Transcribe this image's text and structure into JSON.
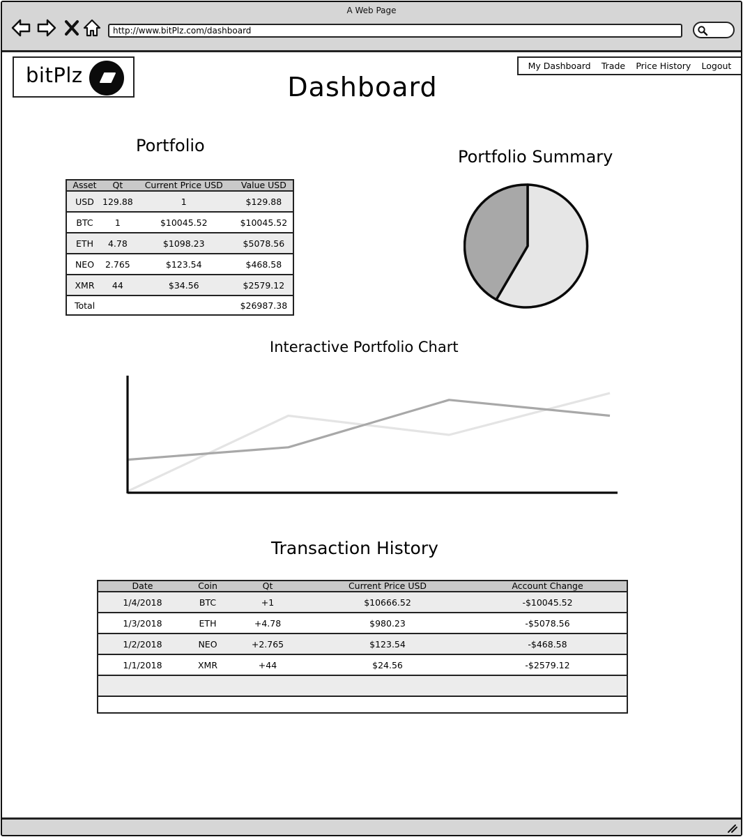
{
  "browser": {
    "window_title": "A Web Page",
    "url": "http://www.bitPlz.com/dashboard"
  },
  "header": {
    "logo_text": "bitPlz",
    "nav": [
      "My Dashboard",
      "Trade",
      "Price History",
      "Logout"
    ],
    "page_title": "Dashboard"
  },
  "portfolio": {
    "title": "Portfolio",
    "columns": [
      "Asset",
      "Qt",
      "Current Price USD",
      "Value USD"
    ],
    "rows": [
      [
        "USD",
        "129.88",
        "1",
        "$129.88"
      ],
      [
        "BTC",
        "1",
        "$10045.52",
        "$10045.52"
      ],
      [
        "ETH",
        "4.78",
        "$1098.23",
        "$5078.56"
      ],
      [
        "NEO",
        "2.765",
        "$123.54",
        "$468.58"
      ],
      [
        "XMR",
        "44",
        "$34.56",
        "$2579.12"
      ]
    ],
    "total_label": "Total",
    "total_value": "$26987.38"
  },
  "summary": {
    "title": "Portfolio Summary",
    "colors": [
      "#e6e6e6",
      "#a8a8a8"
    ]
  },
  "chart": {
    "title": "Interactive Portfolio Chart"
  },
  "chart_data": {
    "type": "line",
    "title": "Interactive Portfolio Chart",
    "x": [
      0,
      1,
      2,
      3
    ],
    "ylim": [
      0,
      10
    ],
    "grid": false,
    "series": [
      {
        "values": [
          0.0,
          6.7,
          5.0,
          8.7
        ],
        "color": "#e4e4e4"
      },
      {
        "values": [
          2.8,
          3.9,
          8.1,
          6.7
        ],
        "color": "#a8a8a8"
      }
    ]
  },
  "history": {
    "title": "Transaction History",
    "columns": [
      "Date",
      "Coin",
      "Qt",
      "Current Price USD",
      "Account Change"
    ],
    "rows": [
      [
        "1/4/2018",
        "BTC",
        "+1",
        "$10666.52",
        "-$10045.52"
      ],
      [
        "1/3/2018",
        "ETH",
        "+4.78",
        "$980.23",
        "-$5078.56"
      ],
      [
        "1/2/2018",
        "NEO",
        "+2.765",
        "$123.54",
        "-$468.58"
      ],
      [
        "1/1/2018",
        "XMR",
        "+44",
        "$24.56",
        "-$2579.12"
      ],
      [
        "",
        "",
        "",
        "",
        ""
      ],
      [
        "",
        "",
        "",
        "",
        ""
      ]
    ]
  },
  "icons": {
    "back": "arrow-left-icon",
    "forward": "arrow-right-icon",
    "stop": "close-icon",
    "home": "home-icon",
    "search": "search-icon",
    "logo": "logo-icon",
    "resize": "resize-grip-icon"
  }
}
